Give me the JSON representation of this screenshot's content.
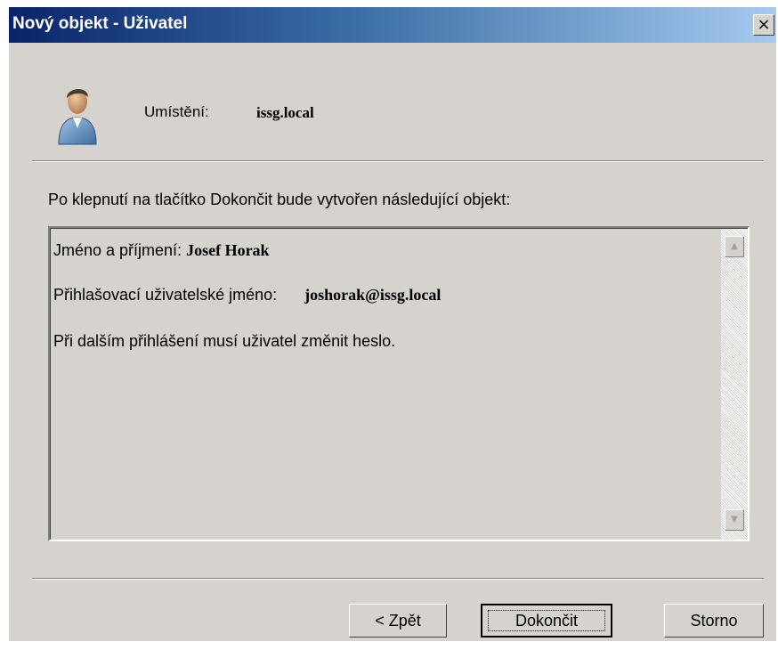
{
  "window": {
    "title": "Nový objekt - Uživatel",
    "close_label": "×"
  },
  "header": {
    "icon": "user-icon",
    "location_label": "Umístění:",
    "location_value": "issg.local"
  },
  "intro": "Po klepnutí na tlačítko Dokončit bude vytvořen následující objekt:",
  "summary": {
    "full_name_label": "Jméno a příjmení:",
    "full_name_value": "Josef Horak",
    "logon_label": "Přihlašovací uživatelské jméno:",
    "logon_value": "joshorak@issg.local",
    "password_note": "Při dalším přihlášení musí uživatel změnit heslo.",
    "scroll_up": "▲",
    "scroll_down": "▼"
  },
  "buttons": {
    "back": "< Zpět",
    "finish": "Dokončit",
    "cancel": "Storno"
  },
  "colors": {
    "dialog_bg": "#d6d3ce",
    "titlebar_start": "#0a246a",
    "titlebar_end": "#a6caf0"
  }
}
